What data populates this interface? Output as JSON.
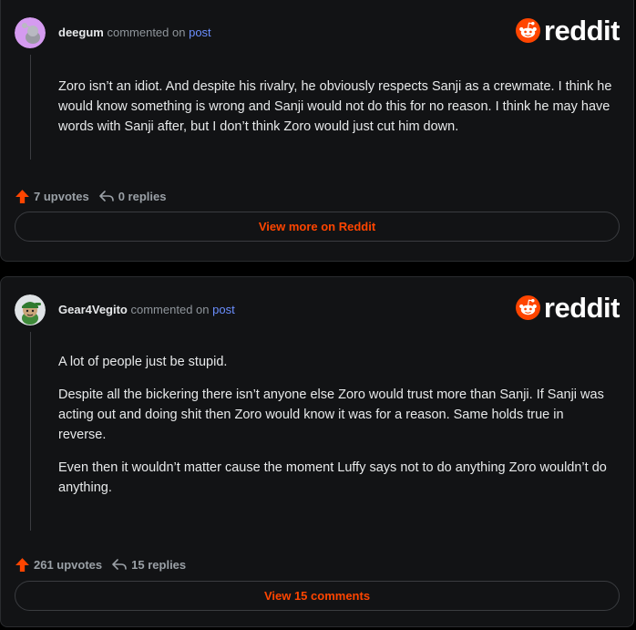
{
  "colors": {
    "background": "#000000",
    "card": "#121315",
    "accent": "#ff4500",
    "link": "#6b8fff",
    "text": "#e7e9ea",
    "muted": "#8f959b"
  },
  "brand": {
    "logo_text": "reddit",
    "icon": "reddit-snoo-icon"
  },
  "comments": [
    {
      "username": "deegum",
      "commented_on": "commented on",
      "post_link": "post",
      "avatar_icon": "snoo-avatar-purple",
      "paragraphs": [
        "Zoro isn’t an idiot. And despite his rivalry, he obviously respects Sanji as a crewmate. I think he would know something is wrong and Sanji would not do this for no reason. I think he may have words with Sanji after, but I don’t think Zoro would just cut him down."
      ],
      "upvotes": "7 upvotes",
      "replies": "0 replies",
      "action_label": "View more on Reddit"
    },
    {
      "username": "Gear4Vegito",
      "commented_on": "commented on",
      "post_link": "post",
      "avatar_icon": "snoo-avatar-green-hat",
      "paragraphs": [
        "A lot of people just be stupid.",
        "Despite all the bickering there isn’t anyone else Zoro would trust more than Sanji. If Sanji was acting out and doing shit then Zoro would know it was for a reason. Same holds true in reverse.",
        "Even then it wouldn’t matter cause the moment Luffy says not to do anything Zoro wouldn’t do anything."
      ],
      "upvotes": "261 upvotes",
      "replies": "15 replies",
      "action_label": "View 15 comments"
    }
  ]
}
